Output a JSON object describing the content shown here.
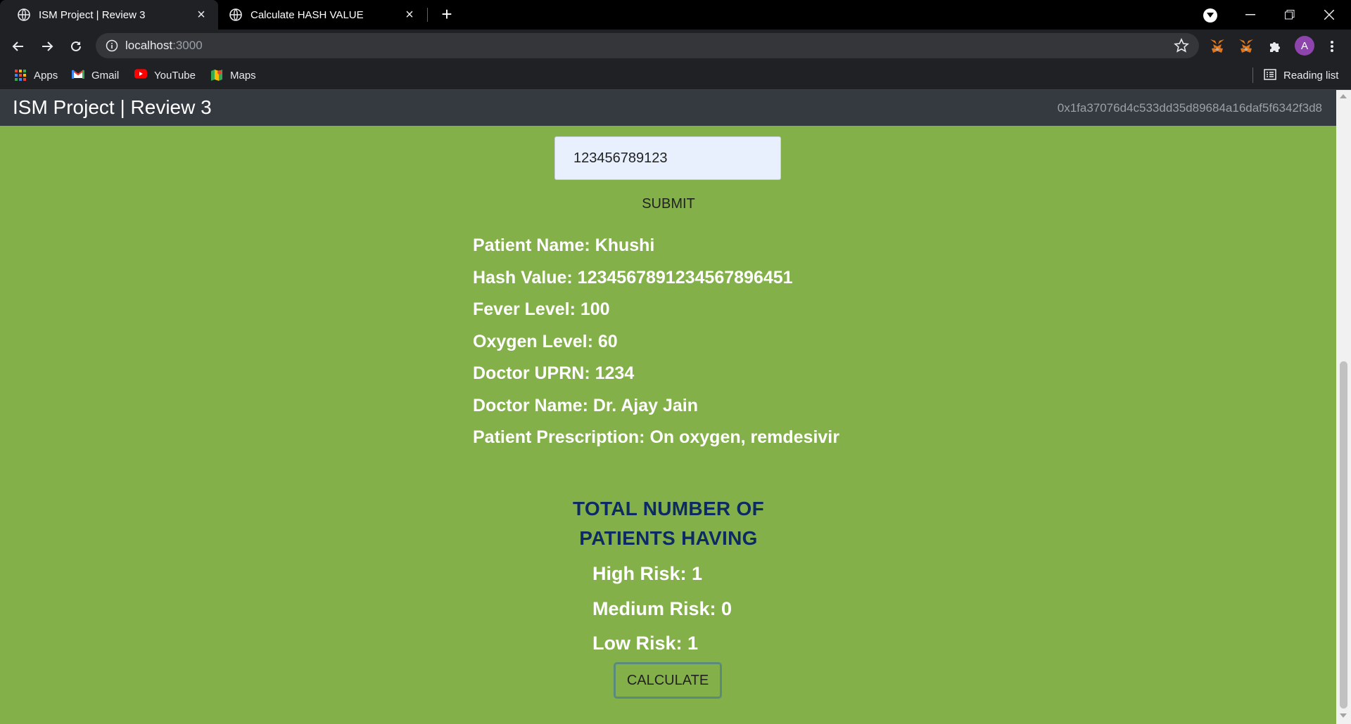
{
  "browser": {
    "tabs": [
      {
        "title": "ISM Project | Review 3",
        "active": true
      },
      {
        "title": "Calculate HASH VALUE",
        "active": false
      }
    ],
    "url_host": "localhost",
    "url_port": ":3000",
    "bookmarks": [
      "Apps",
      "Gmail",
      "YouTube",
      "Maps"
    ],
    "reading_list": "Reading list",
    "profile_initial": "A"
  },
  "appbar": {
    "title": "ISM Project | Review 3",
    "account": "0x1fa37076d4c533dd35d89684a16daf5f6342f3d8"
  },
  "form": {
    "hash_input_value": "123456789123",
    "submit_label": "SUBMIT"
  },
  "patient": {
    "name": "Patient Name: Khushi",
    "hash": "Hash Value: 123456789123456789645​1",
    "fever": "Fever Level: 100",
    "oxygen": "Oxygen Level: 60",
    "doctor_uprn": "Doctor UPRN: 1234",
    "doctor_name": "Doctor Name: Dr. Ajay Jain",
    "prescription": "Patient Prescription: On oxygen, remdesivir"
  },
  "summary": {
    "title_line1": "TOTAL NUMBER OF",
    "title_line2": "PATIENTS HAVING",
    "high": "High Risk: 1",
    "medium": "Medium Risk: 0",
    "low": "Low Risk: 1",
    "calculate_label": "CALCULATE"
  },
  "colors": {
    "page_bg": "#84b04a",
    "appbar_bg": "#343a40",
    "summary_title": "#0d2b63"
  }
}
